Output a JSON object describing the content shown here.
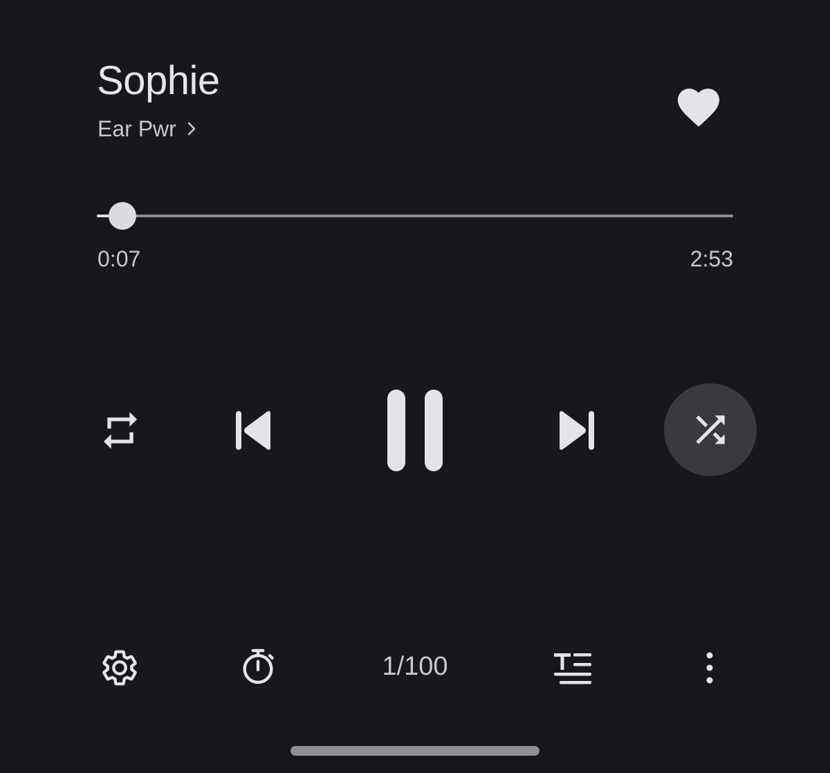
{
  "now_playing": {
    "title": "Sophie",
    "artist": "Ear Pwr",
    "favorited": true
  },
  "progress": {
    "elapsed": "0:07",
    "total": "2:53",
    "fraction": 0.04
  },
  "controls": {
    "repeat_icon": "repeat-icon",
    "previous_icon": "skip-previous-icon",
    "play_state_icon": "pause-icon",
    "next_icon": "skip-next-icon",
    "shuffle_icon": "shuffle-icon",
    "shuffle_active": true
  },
  "bottom_bar": {
    "settings_icon": "gear-icon",
    "timer_icon": "stopwatch-icon",
    "queue_position": "1/100",
    "lyrics_icon": "lyrics-icon",
    "more_icon": "more-vertical-icon"
  },
  "colors": {
    "background": "#17181b",
    "foreground": "#e4e4e8",
    "muted": "#c9c9cd",
    "shuffle_bg": "#3a3a3e"
  }
}
